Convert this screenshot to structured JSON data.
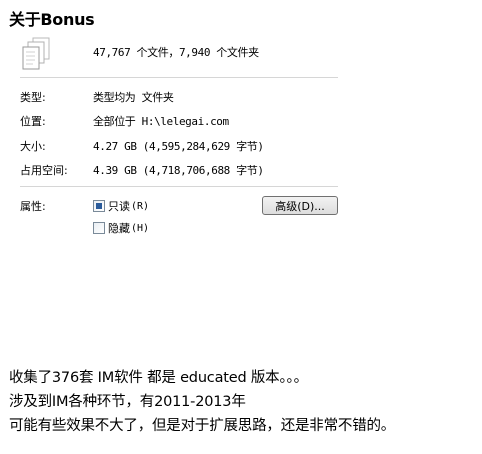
{
  "dialog": {
    "title": "关于Bonus",
    "summary": "47,767 个文件，7,940 个文件夹",
    "rows": [
      {
        "label": "类型:",
        "value": "类型均为 文件夹"
      },
      {
        "label": "位置:",
        "value": "全部位于 H:\\lelegai.com"
      },
      {
        "label": "大小:",
        "value": "4.27 GB (4,595,284,629 字节)"
      },
      {
        "label": "占用空间:",
        "value": "4.39 GB (4,718,706,688 字节)"
      }
    ],
    "attributes": {
      "label": "属性:",
      "readonly_label": "只读",
      "readonly_shortcut": "(R)",
      "readonly_state": "indeterminate",
      "hidden_label": "隐藏",
      "hidden_shortcut": "(H)",
      "hidden_state": "unchecked",
      "advanced_button": "高级(D)..."
    }
  },
  "caption": {
    "lines": [
      "收集了376套 IM软件 都是 educated 版本。。。",
      "涉及到IM各种环节，有2011-2013年",
      "可能有些效果不大了，但是对于扩展思路，还是非常不错的。"
    ]
  },
  "icons": {
    "summary": "multiple-files-icon"
  }
}
